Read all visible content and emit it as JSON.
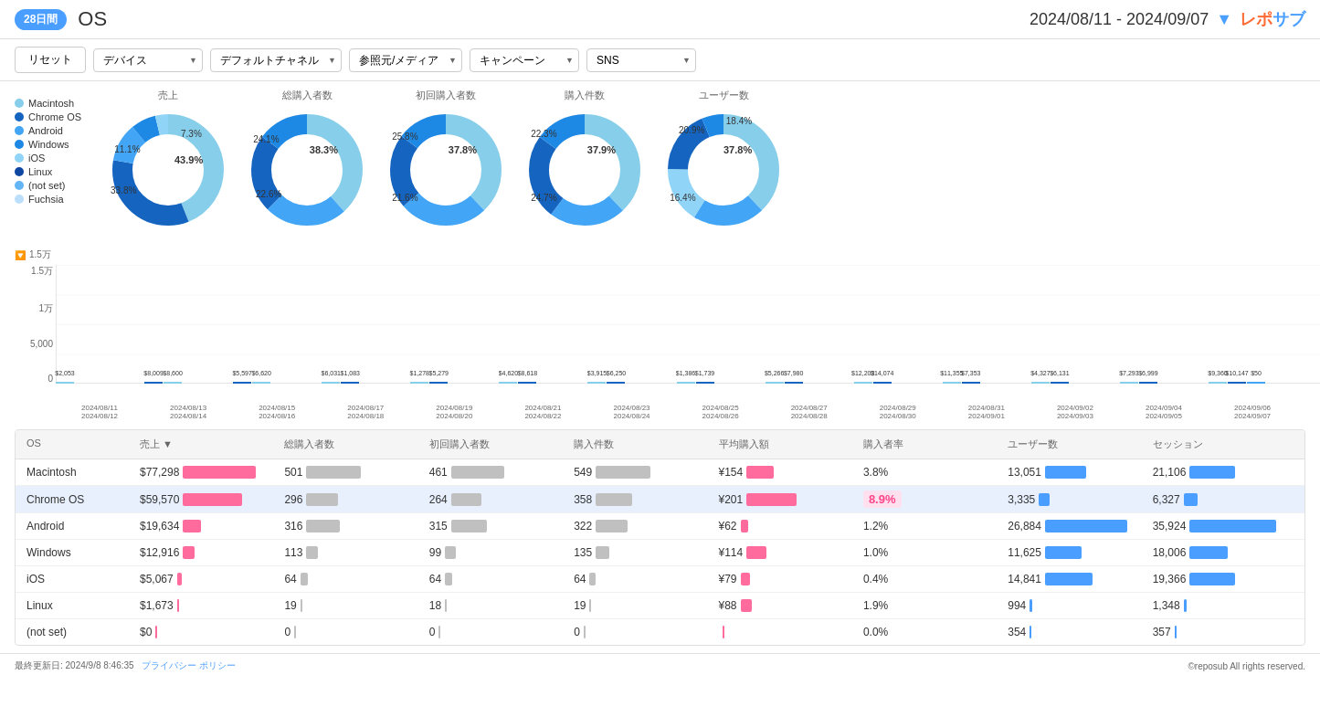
{
  "header": {
    "badge": "28日間",
    "title": "OS",
    "date_range": "2024/08/11 - 2024/09/07",
    "logo": "レポサブ"
  },
  "filters": {
    "reset_label": "リセット",
    "device_label": "デバイス",
    "channel_label": "デフォルトチャネル",
    "source_label": "参照元/メディア",
    "campaign_label": "キャンペーン",
    "sns_label": "SNS"
  },
  "legend": {
    "items": [
      {
        "label": "Macintosh",
        "color": "#87ceeb"
      },
      {
        "label": "Chrome OS",
        "color": "#1565c0"
      },
      {
        "label": "Android",
        "color": "#42a5f5"
      },
      {
        "label": "Windows",
        "color": "#1e88e5"
      },
      {
        "label": "iOS",
        "color": "#90d4f7"
      },
      {
        "label": "Linux",
        "color": "#0d47a1"
      },
      {
        "label": "(not set)",
        "color": "#64b5f6"
      },
      {
        "label": "Fuchsia",
        "color": "#bbdefb"
      }
    ]
  },
  "donuts": [
    {
      "label": "売上",
      "center": "",
      "segments": [
        {
          "label": "Macintosh",
          "value": 43.9,
          "color": "#87ceeb"
        },
        {
          "label": "Chrome OS",
          "value": 33.8,
          "color": "#1565c0"
        },
        {
          "label": "Android",
          "value": 11.1,
          "color": "#42a5f5"
        },
        {
          "label": "Windows",
          "value": 7.3,
          "color": "#1e88e5"
        },
        {
          "label": "Others",
          "value": 3.9,
          "color": "#90d4f7"
        }
      ],
      "annotations": [
        "43.9%",
        "33.8%",
        "11.1%",
        "7.3%"
      ]
    },
    {
      "label": "総購入者数",
      "segments": [
        {
          "label": "Macintosh",
          "value": 38.3,
          "color": "#87ceeb"
        },
        {
          "label": "Chrome OS",
          "value": 22.6,
          "color": "#1565c0"
        },
        {
          "label": "Android",
          "value": 24.1,
          "color": "#42a5f5"
        },
        {
          "label": "Others",
          "value": 15,
          "color": "#1e88e5"
        }
      ],
      "annotations": [
        "38.3%",
        "24.1%",
        "22.6%"
      ]
    },
    {
      "label": "初回購入者数",
      "segments": [
        {
          "label": "Macintosh",
          "value": 37.8,
          "color": "#87ceeb"
        },
        {
          "label": "Chrome OS",
          "value": 21.6,
          "color": "#1565c0"
        },
        {
          "label": "Android",
          "value": 25.8,
          "color": "#42a5f5"
        },
        {
          "label": "Others",
          "value": 14.8,
          "color": "#1e88e5"
        }
      ],
      "annotations": [
        "37.8%",
        "25.8%",
        "21.6%"
      ]
    },
    {
      "label": "購入件数",
      "segments": [
        {
          "label": "Macintosh",
          "value": 37.9,
          "color": "#87ceeb"
        },
        {
          "label": "Chrome OS",
          "value": 24.7,
          "color": "#1565c0"
        },
        {
          "label": "Android",
          "value": 22.3,
          "color": "#42a5f5"
        },
        {
          "label": "Others",
          "value": 15.1,
          "color": "#1e88e5"
        }
      ],
      "annotations": [
        "37.9%",
        "24.7%",
        "22.3%"
      ]
    },
    {
      "label": "ユーザー数",
      "segments": [
        {
          "label": "Macintosh",
          "value": 37.8,
          "color": "#87ceeb"
        },
        {
          "label": "Android",
          "value": 20.9,
          "color": "#42a5f5"
        },
        {
          "label": "iOS",
          "value": 16.4,
          "color": "#90d4f7"
        },
        {
          "label": "Windows",
          "value": 6.5,
          "color": "#1e88e5"
        },
        {
          "label": "Chrome OS",
          "value": 18.4,
          "color": "#1565c0"
        }
      ],
      "annotations": [
        "37.8%",
        "20.9%",
        "18.4%",
        "16.4%"
      ]
    }
  ],
  "bar_chart": {
    "y_labels": [
      "1.5万",
      "1万",
      "5,000",
      "0"
    ],
    "bars": [
      {
        "date": "2024/08/11\n2024/08/12",
        "value": 2053,
        "label": "$2,053"
      },
      {
        "date": "2024/08/13\n2024/08/14",
        "value": 8009,
        "label": "$8,009"
      },
      {
        "date": "2024/08/13\n2024/08/14",
        "value": 8600,
        "label": "$8,600"
      },
      {
        "date": "2024/08/15\n2024/08/16",
        "value": 5597,
        "label": "$5,597"
      },
      {
        "date": "2024/08/15\n2024/08/16",
        "value": 6620,
        "label": "$6,620"
      },
      {
        "date": "2024/08/17\n2024/08/18",
        "value": 6031,
        "label": "$6,031"
      },
      {
        "date": "2024/08/17\n2024/08/18",
        "value": 1083,
        "label": "$1,083"
      },
      {
        "date": "2024/08/19\n2024/08/20",
        "value": 1278,
        "label": "$1,278"
      },
      {
        "date": "2024/08/19\n2024/08/20",
        "value": 5279,
        "label": "$5,279"
      },
      {
        "date": "2024/08/21\n2024/08/22",
        "value": 4620,
        "label": "$4,620"
      },
      {
        "date": "2024/08/21\n2024/08/22",
        "value": 8618,
        "label": "$8,618"
      },
      {
        "date": "2024/08/23\n2024/08/24",
        "value": 3915,
        "label": "$3,915"
      },
      {
        "date": "2024/08/23\n2024/08/24",
        "value": 6250,
        "label": "$6,250"
      },
      {
        "date": "2024/08/25\n2024/08/26",
        "value": 1386,
        "label": "$1,386"
      },
      {
        "date": "2024/08/25\n2024/08/26",
        "value": 1739,
        "label": "$1,739"
      },
      {
        "date": "2024/08/27\n2024/08/28",
        "value": 5266,
        "label": "$5,266"
      },
      {
        "date": "2024/08/27\n2024/08/28",
        "value": 7980,
        "label": "$7,980"
      },
      {
        "date": "2024/08/29\n2024/08/30",
        "value": 14074,
        "label": "$14,074"
      },
      {
        "date": "2024/08/29\n2024/08/30",
        "value": 12203,
        "label": "$12,203"
      },
      {
        "date": "2024/08/31\n2024/09/01",
        "value": 11355,
        "label": "$11,355"
      },
      {
        "date": "2024/08/31\n2024/09/01",
        "value": 7353,
        "label": "$7,353"
      },
      {
        "date": "2024/09/02\n2024/09/03",
        "value": 4327,
        "label": "$4,327"
      },
      {
        "date": "2024/09/02\n2024/09/03",
        "value": 6131,
        "label": "$6,131"
      },
      {
        "date": "2024/09/04\n2024/09/05",
        "value": 7293,
        "label": "$7,293"
      },
      {
        "date": "2024/09/04\n2024/09/05",
        "value": 6999,
        "label": "$6,999"
      },
      {
        "date": "2024/09/06\n2024/09/07",
        "value": 9360,
        "label": "$9,360"
      },
      {
        "date": "2024/09/06\n2024/09/07",
        "value": 10147,
        "label": "$10,147"
      },
      {
        "date": "2024/09/06\n2024/09/07",
        "value": 50,
        "label": "$50"
      }
    ]
  },
  "table": {
    "headers": [
      "OS",
      "売上 ▼",
      "総購入者数",
      "初回購入者数",
      "購入件数",
      "平均購入額",
      "購入者率",
      "ユーザー数",
      "セッション"
    ],
    "rows": [
      {
        "os": "Macintosh",
        "revenue": "$77,298",
        "revenue_bar": 80,
        "buyers": "501",
        "buyers_bar": 60,
        "new_buyers": "461",
        "new_buyers_bar": 58,
        "purchases": "549",
        "purchases_bar": 60,
        "avg": "¥154",
        "avg_bar": 30,
        "rate": "3.8%",
        "rate_color": "normal",
        "users": "13,051",
        "users_bar": 45,
        "sessions": "21,106",
        "sessions_bar": 50,
        "highlighted": false
      },
      {
        "os": "Chrome OS",
        "revenue": "$59,570",
        "revenue_bar": 65,
        "buyers": "296",
        "buyers_bar": 35,
        "new_buyers": "264",
        "new_buyers_bar": 33,
        "purchases": "358",
        "purchases_bar": 40,
        "avg": "¥201",
        "avg_bar": 55,
        "rate": "8.9%",
        "rate_color": "pink",
        "users": "3,335",
        "users_bar": 12,
        "sessions": "6,327",
        "sessions_bar": 15,
        "highlighted": true
      },
      {
        "os": "Android",
        "revenue": "$19,634",
        "revenue_bar": 20,
        "buyers": "316",
        "buyers_bar": 37,
        "new_buyers": "315",
        "new_buyers_bar": 39,
        "purchases": "322",
        "purchases_bar": 35,
        "avg": "¥62",
        "avg_bar": 8,
        "rate": "1.2%",
        "rate_color": "normal",
        "users": "26,884",
        "users_bar": 90,
        "sessions": "35,924",
        "sessions_bar": 95,
        "highlighted": false
      },
      {
        "os": "Windows",
        "revenue": "$12,916",
        "revenue_bar": 13,
        "buyers": "113",
        "buyers_bar": 13,
        "new_buyers": "99",
        "new_buyers_bar": 12,
        "purchases": "135",
        "purchases_bar": 15,
        "avg": "¥114",
        "avg_bar": 22,
        "rate": "1.0%",
        "rate_color": "normal",
        "users": "11,625",
        "users_bar": 40,
        "sessions": "18,006",
        "sessions_bar": 42,
        "highlighted": false
      },
      {
        "os": "iOS",
        "revenue": "$5,067",
        "revenue_bar": 5,
        "buyers": "64",
        "buyers_bar": 8,
        "new_buyers": "64",
        "new_buyers_bar": 8,
        "purchases": "64",
        "purchases_bar": 7,
        "avg": "¥79",
        "avg_bar": 10,
        "rate": "0.4%",
        "rate_color": "normal",
        "users": "14,841",
        "users_bar": 52,
        "sessions": "19,366",
        "sessions_bar": 50,
        "highlighted": false
      },
      {
        "os": "Linux",
        "revenue": "$1,673",
        "revenue_bar": 2,
        "buyers": "19",
        "buyers_bar": 2,
        "new_buyers": "18",
        "new_buyers_bar": 2,
        "purchases": "19",
        "purchases_bar": 2,
        "avg": "¥88",
        "avg_bar": 12,
        "rate": "1.9%",
        "rate_color": "normal",
        "users": "994",
        "users_bar": 3,
        "sessions": "1,348",
        "sessions_bar": 3,
        "highlighted": false
      },
      {
        "os": "(not set)",
        "revenue": "$0",
        "revenue_bar": 0,
        "buyers": "0",
        "buyers_bar": 0,
        "new_buyers": "0",
        "new_buyers_bar": 0,
        "purchases": "0",
        "purchases_bar": 0,
        "avg": "",
        "avg_bar": 2,
        "rate": "0.0%",
        "rate_color": "normal",
        "users": "354",
        "users_bar": 1,
        "sessions": "357",
        "sessions_bar": 1,
        "highlighted": false
      }
    ]
  },
  "footer": {
    "last_update": "最終更新日: 2024/9/8 8:46:35",
    "privacy_link": "プライバシー ポリシー",
    "copyright": "©reposub All rights reserved."
  }
}
